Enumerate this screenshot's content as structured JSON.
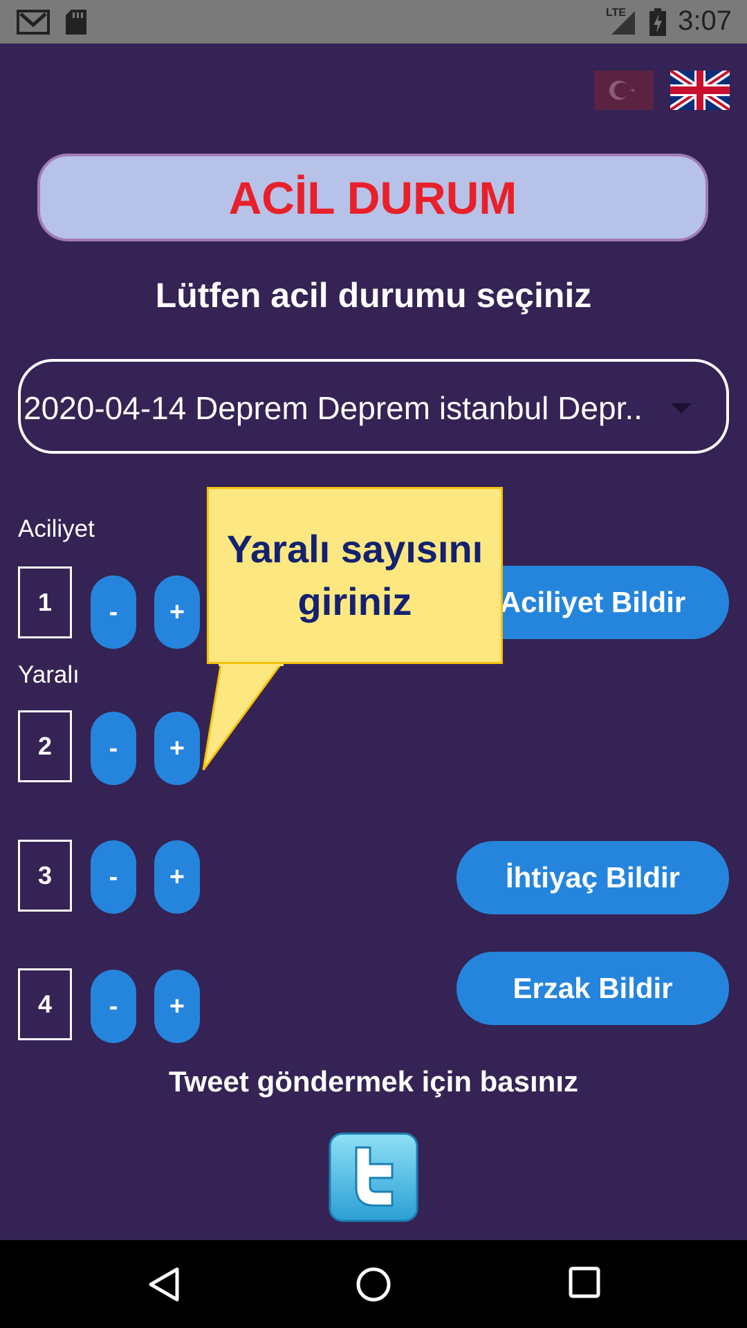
{
  "status_bar": {
    "time": "3:07",
    "network_label": "LTE",
    "icons": [
      "gmail-icon",
      "sd-card-icon",
      "signal-icon",
      "battery-icon"
    ]
  },
  "flags": [
    "turkey-flag-icon",
    "uk-flag-icon"
  ],
  "header": {
    "title": "ACİL DURUM"
  },
  "subtitle": "Lütfen acil durumu seçiniz",
  "dropdown": {
    "selected": "2020-04-14 Deprem Deprem istanbul Depr.."
  },
  "aciliyet": {
    "label": "Aciliyet",
    "value": "1",
    "minus": "-",
    "plus": "+",
    "button": "Aciliyet Bildir"
  },
  "yarali": {
    "label": "Yaralı",
    "value": "2",
    "minus": "-",
    "plus": "+"
  },
  "tooltip": {
    "text_line1": "Yaralı sayısını",
    "text_line2": "giriniz"
  },
  "ihtiyac": {
    "value": "3",
    "minus": "-",
    "plus": "+",
    "button": "İhtiyaç Bildir"
  },
  "erzak": {
    "value": "4",
    "minus": "-",
    "plus": "+",
    "button": "Erzak Bildir"
  },
  "tweet": {
    "prompt": "Tweet göndermek için basınız"
  },
  "navigation": [
    "back-icon",
    "home-icon",
    "recents-icon"
  ],
  "colors": {
    "background": "#342354",
    "header_bg": "#b7c2e8",
    "header_text": "#e8202a",
    "button_blue": "#2585dc",
    "tooltip_bg": "#fde780",
    "tooltip_text": "#142170"
  }
}
